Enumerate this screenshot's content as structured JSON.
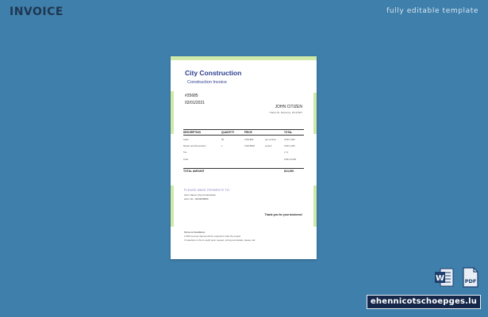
{
  "header": {
    "title": "INVOICE",
    "tagline": "fully editable template"
  },
  "invoice": {
    "company": "City Construction",
    "subtitle": "Construction  Invoice",
    "number": "#25685",
    "date": "02/01/2021",
    "customer_name": "JOHN CITIZEN",
    "customer_address": "7 Elton St. Pinecove, KS 67007",
    "columns": [
      "DESCRIPTION",
      "QUANTITY",
      "PRICE",
      "TOTAL"
    ],
    "rows": [
      {
        "desc": "Labor",
        "qty": "50",
        "price": "USD $80",
        "unit": "per-contrat",
        "total": "USD 4,000"
      },
      {
        "desc": "Repair and Renovation",
        "qty": "1",
        "price": "USD $800",
        "unit": "project",
        "total": "USD 4,000"
      },
      {
        "desc": "Tax",
        "qty": "",
        "price": "",
        "unit": "",
        "total": "1 %"
      },
      {
        "desc": "Total",
        "qty": "",
        "price": "",
        "unit": "",
        "total": "USD 10,000"
      }
    ],
    "total_label": "TOTAL AMOUNT",
    "total_value": "$14,000",
    "payment_title": "PLEASE MAKE PAYMENTS TO:",
    "account_name": "Acct. Name: City Construction",
    "account_no": "Acct. No.: 0234056890",
    "thanks": "Thank you for your business!",
    "terms_title": "Terms & Conditions",
    "terms_1": "A 30% security deposit will be required to start the project.",
    "terms_2": "If materials on the in-ought upon request, pricing and details, please call."
  },
  "icons": {
    "word": "word-icon",
    "pdf": "pdf-icon"
  },
  "brand": "ehennicotschoepges.lu"
}
